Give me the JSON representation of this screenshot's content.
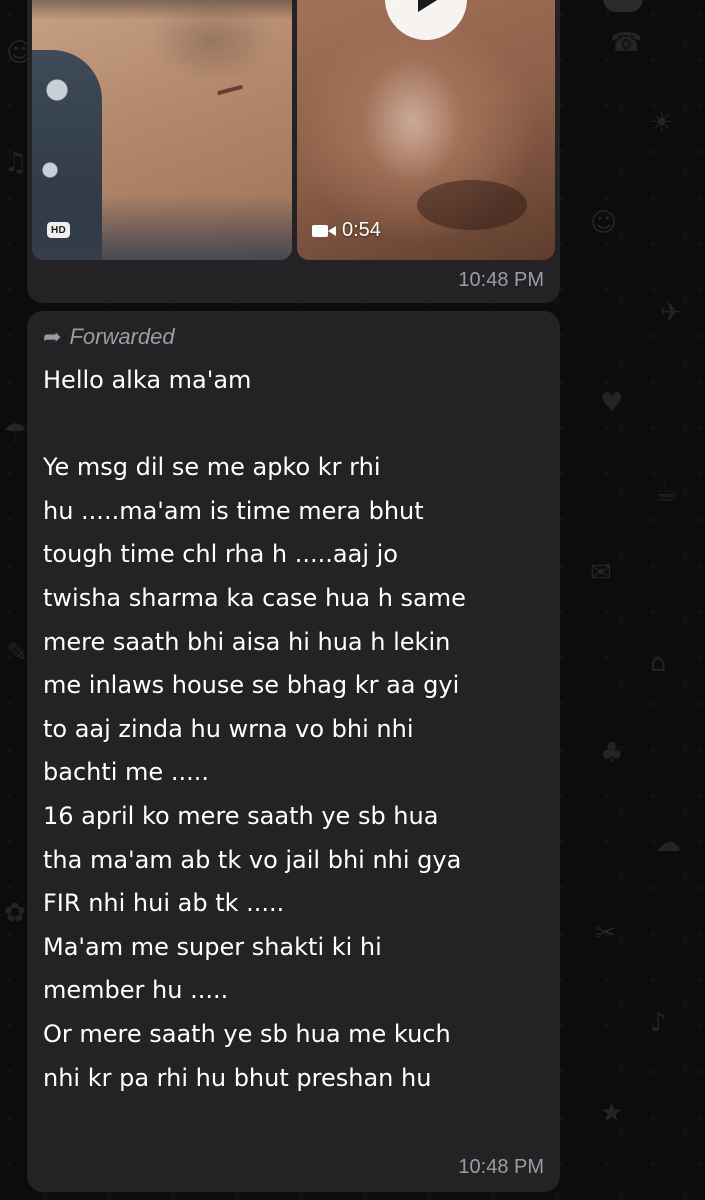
{
  "media_message": {
    "photo_quality_badge": "HD",
    "video_duration": "0:54",
    "time": "10:48 PM",
    "icons": [
      "video-camera-icon",
      "play-icon"
    ]
  },
  "text_message": {
    "forwarded_label": "Forwarded",
    "forward_icon": "forward-arrow-icon",
    "body": "Hello alka ma'am\n\nYe msg dil se me apko kr rhi\nhu .....ma'am is time mera bhut\ntough time chl rha h .....aaj jo\ntwisha sharma ka case hua h same\nmere saath bhi aisa hi hua h lekin\nme inlaws house se bhag kr aa gyi\nto aaj zinda hu wrna vo bhi nhi\nbachti me .....\n16 april ko mere saath ye sb hua\ntha ma'am ab tk vo jail bhi nhi gya\nFIR nhi hui ab tk .....\nMa'am me super shakti ki hi\nmember hu .....\nOr mere saath ye sb hua me kuch\nnhi kr pa rhi hu bhut preshan hu",
    "time": "10:48 PM"
  },
  "colors": {
    "background": "#0c0c0d",
    "bubble": "#232325",
    "text": "#ffffff",
    "meta_text": "#9c9ca2"
  }
}
